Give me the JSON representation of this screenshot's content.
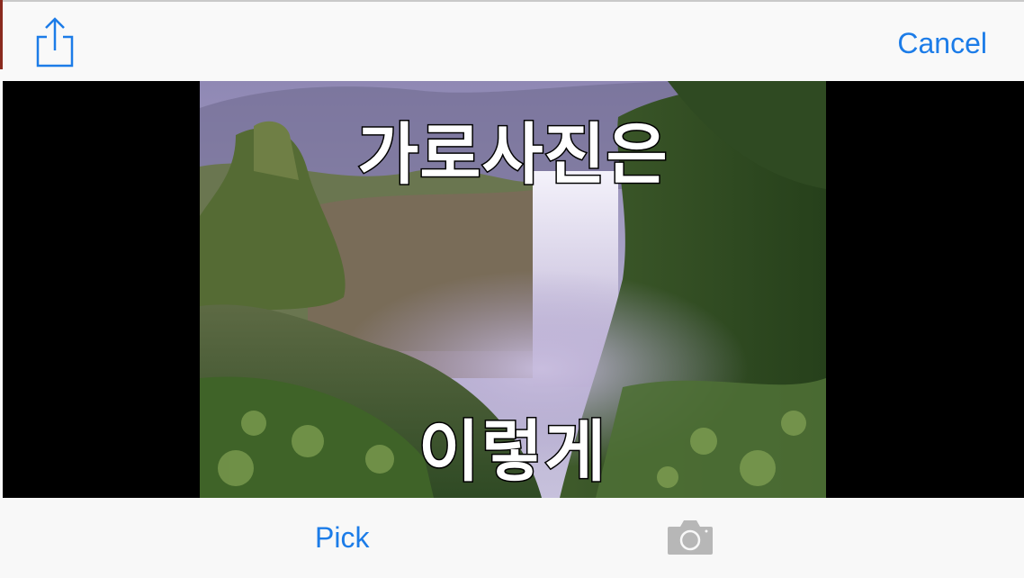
{
  "header": {
    "share_icon": "share-icon",
    "cancel_label": "Cancel"
  },
  "preview": {
    "caption_top": "가로사진은",
    "caption_bottom": "이렇게"
  },
  "footer": {
    "pick_label": "Pick",
    "camera_icon": "camera-icon"
  },
  "colors": {
    "accent": "#1c7ce8",
    "bar_background": "#f8f8f8",
    "viewer_background": "#000000",
    "disabled_icon": "#b7b7b7"
  }
}
